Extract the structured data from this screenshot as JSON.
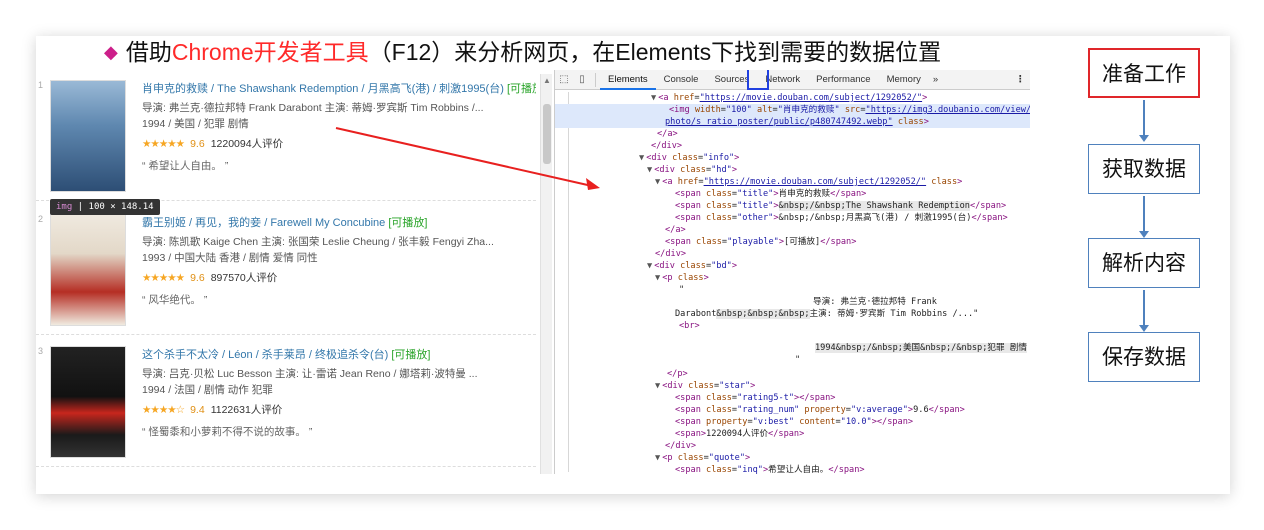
{
  "title": {
    "prefix": "借助",
    "highlight": "Chrome开发者工具",
    "suffix": "（F12）来分析网页，在Elements下找到需要的数据位置"
  },
  "movies": [
    {
      "num": "1",
      "title": "肖申克的救赎 / The Shawshank Redemption / 月黑高飞(港) / 刺激1995(台)",
      "playable": "[可播放]",
      "crew": "导演: 弗兰克·德拉邦特 Frank Darabont   主演: 蒂姆·罗宾斯 Tim Robbins /...",
      "meta": "1994 / 美国 / 犯罪 剧情",
      "stars": "★★★★★",
      "score": "9.6",
      "votes": "1220094人评价",
      "quote": "“ 希望让人自由。 ”",
      "poster_colors": [
        "#7fa9cc",
        "#2d4e75"
      ]
    },
    {
      "num": "2",
      "title": "霸王别姬 / 再见，我的妾 / Farewell My Concubine",
      "playable": "[可播放]",
      "crew": "导演: 陈凯歌 Kaige Chen   主演: 张国荣 Leslie Cheung / 张丰毅 Fengyi Zha...",
      "meta": "1993 / 中国大陆 香港 / 剧情 爱情 同性",
      "stars": "★★★★★",
      "score": "9.6",
      "votes": "897570人评价",
      "quote": "“ 风华绝代。 ”",
      "poster_colors": [
        "#e8e0d4",
        "#b22a22"
      ]
    },
    {
      "num": "3",
      "title": "这个杀手不太冷 / Léon / 杀手莱昂 / 终极追杀令(台)",
      "playable": "[可播放]",
      "crew": "导演: 吕克·贝松 Luc Besson   主演: 让·雷诺 Jean Reno / 娜塔莉·波特曼 ...",
      "meta": "1994 / 法国 / 剧情 动作 犯罪",
      "stars": "★★★★☆",
      "score": "9.4",
      "votes": "1122631人评价",
      "quote": "“ 怪蜀黍和小萝莉不得不说的故事。 ”",
      "poster_colors": [
        "#1a1a1a",
        "#c8261d"
      ]
    }
  ],
  "tooltip": {
    "tag": "img",
    "size": "100 × 148.14"
  },
  "devtools": {
    "tabs": [
      "Elements",
      "Console",
      "Sources",
      "Network",
      "Performance",
      "Memory"
    ],
    "more": "»",
    "kebab": "⋮"
  },
  "dom_lines": {
    "l1": "\"https://movie.douban.com/subject/1292052/\"",
    "l2_w": "\"100\"",
    "l2_alt": "\"肖申克的救赎\"",
    "l2_src": "\"https://img3.doubanio.com/view/",
    "l3": "photo/s_ratio_poster/public/p480747492.webp\"",
    "l7": "\"https://movie.douban.com/subject/1292052/\"",
    "t1": "肖申克的救赎",
    "t2": "&nbsp;/&nbsp;The Shawshank Redemption",
    "t3": "&nbsp;/&nbsp;月黑高飞(港)  /  刺激1995(台)",
    "playable": "[可播放]",
    "director": "导演: 弗兰克·德拉邦特 Frank",
    "director2": "Darabont",
    "director3": "&nbsp;&nbsp;&nbsp;",
    "director4": "主演: 蒂姆·罗宾斯 Tim Robbins /...\"",
    "year": "1994&nbsp;/&nbsp;美国&nbsp;/&nbsp;犯罪 剧情",
    "rating_num": "9.6",
    "votes": "1220094人评价",
    "inq": "希望让人自由。"
  },
  "flow": [
    "准备工作",
    "获取数据",
    "解析内容",
    "保存数据"
  ]
}
